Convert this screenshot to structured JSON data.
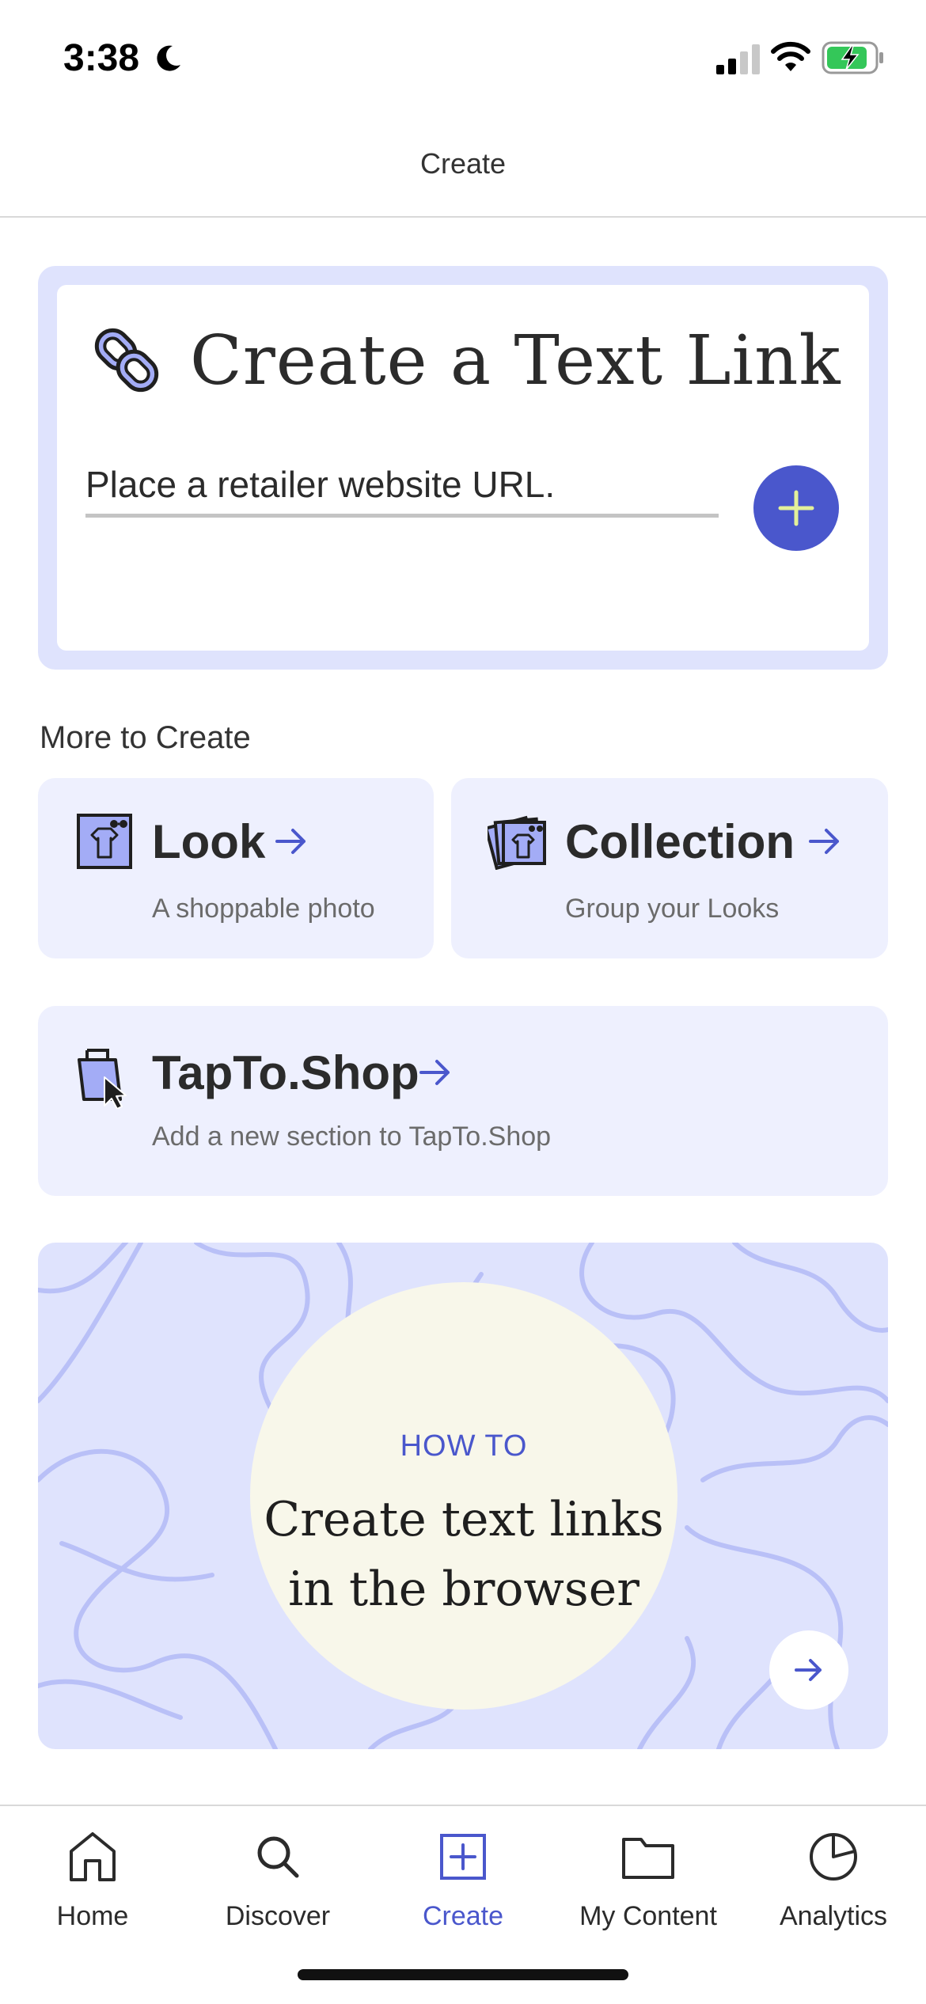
{
  "status_bar": {
    "time": "3:38"
  },
  "header": {
    "title": "Create"
  },
  "text_link": {
    "title": "Create a Text Link",
    "placeholder": "Place a retailer website URL."
  },
  "more": {
    "heading": "More to Create",
    "look": {
      "title": "Look",
      "subtitle": "A shoppable photo"
    },
    "collection": {
      "title": "Collection",
      "subtitle": "Group your Looks"
    },
    "shop": {
      "title": "TapTo.Shop",
      "subtitle": "Add a new section to TapTo.Shop"
    }
  },
  "howto": {
    "label": "HOW TO",
    "text": "Create text links in the browser"
  },
  "tabs": [
    {
      "label": "Home",
      "icon": "home-icon"
    },
    {
      "label": "Discover",
      "icon": "search-icon"
    },
    {
      "label": "Create",
      "icon": "create-icon",
      "active": true
    },
    {
      "label": "My Content",
      "icon": "folder-icon"
    },
    {
      "label": "Analytics",
      "icon": "pie-chart-icon"
    }
  ],
  "colors": {
    "accent": "#4a57cc",
    "card_bg": "#dfe3fd",
    "tile_bg": "#eef0fe",
    "howto_circle": "#f8f7ea"
  }
}
